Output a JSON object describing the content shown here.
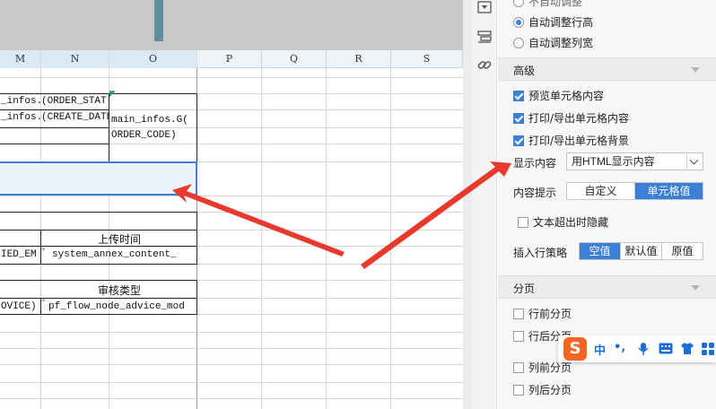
{
  "sheet": {
    "columns": [
      "M",
      "N",
      "O",
      "P",
      "Q",
      "R",
      "S"
    ],
    "cells": {
      "m_order_stat": "_infos.G",
      "n_order_stat": "(ORDER_STAT",
      "m_create_date": "_infos.G",
      "n_create_date": "(CREATE_DATE",
      "o_order_code_1": "main_infos.G(",
      "o_order_code_2": "ORDER_CODE)",
      "upload_time_label": "上传时间",
      "m_upload": "IED_EM",
      "n_upload": "system_annex_content_",
      "review_type_label": "审核类型",
      "m_review": "OVICE)",
      "n_review": "pf_flow_node_advice_mod"
    }
  },
  "panel": {
    "radio_top_cut": "不自动调整",
    "radio_row_height": "自动调整行高",
    "radio_col_width": "自动调整列宽",
    "advanced_section": "高级",
    "chk_preview": "预览单元格内容",
    "chk_print_content": "打印/导出单元格内容",
    "chk_print_bg": "打印/导出单元格背景",
    "display_content_label": "显示内容",
    "display_content_value": "用HTML显示内容",
    "content_tip_label": "内容提示",
    "content_tip_options": [
      "自定义",
      "单元格值"
    ],
    "chk_overflow_hide": "文本超出时隐藏",
    "insert_policy_label": "插入行策略",
    "insert_policy_options": [
      "空值",
      "默认值",
      "原值"
    ],
    "paging_section": "分页",
    "chk_row_before": "行前分页",
    "chk_row_after": "行后分页",
    "chk_col_before": "列前分页",
    "chk_col_after": "列后分页"
  },
  "ime": {
    "logo": "S",
    "lang": "中",
    "punct": "•,"
  },
  "colors": {
    "accent": "#3b7fd6",
    "arrow": "#e8392c",
    "ime_brand": "#f26522"
  }
}
